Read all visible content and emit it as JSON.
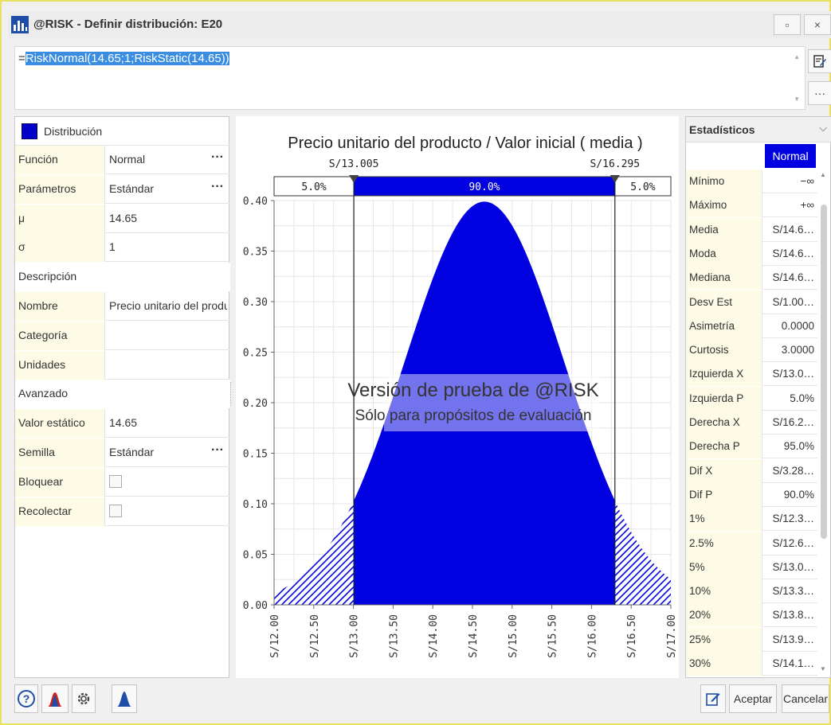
{
  "window": {
    "title": "@RISK - Definir distribución: E20",
    "restore_glyph": "▫",
    "close_glyph": "×"
  },
  "formula": {
    "prefix": "=",
    "selected": "RiskNormal(14.65;1;RiskStatic(14.65))",
    "side_button_1_icon": "edit-icon",
    "side_button_2_label": "···"
  },
  "left_panel": {
    "header_label": "Distribución",
    "swatch_color": "#0000c8",
    "rows": [
      {
        "key": "Función",
        "value": "Normal",
        "has_dots": true,
        "type": "field"
      },
      {
        "key": "Parámetros",
        "value": "Estándar",
        "has_dots": true,
        "type": "field"
      },
      {
        "key": "μ",
        "value": "14.65",
        "has_dots": false,
        "type": "field"
      },
      {
        "key": "σ",
        "value": "1",
        "has_dots": false,
        "type": "field"
      },
      {
        "key": "Descripción",
        "value": "",
        "has_dots": false,
        "type": "section"
      },
      {
        "key": "Nombre",
        "value": "Precio unitario del producto / Valor inicial ( media )",
        "has_dots": false,
        "type": "field"
      },
      {
        "key": "Categoría",
        "value": "",
        "has_dots": false,
        "type": "field"
      },
      {
        "key": "Unidades",
        "value": "",
        "has_dots": false,
        "type": "field"
      },
      {
        "key": "Avanzado",
        "value": "",
        "has_dots": false,
        "type": "section"
      },
      {
        "key": "Valor estático",
        "value": "14.65",
        "has_dots": false,
        "type": "field"
      },
      {
        "key": "Semilla",
        "value": "Estándar",
        "has_dots": true,
        "type": "field"
      },
      {
        "key": "Bloquear",
        "value": "",
        "has_dots": false,
        "type": "checkbox"
      },
      {
        "key": "Recolectar",
        "value": "",
        "has_dots": false,
        "type": "checkbox"
      }
    ],
    "dots_label": "···"
  },
  "chart": {
    "watermark_line1": "Versión de prueba de @RISK",
    "watermark_line2": "Sólo para propósitos de evaluación"
  },
  "chart_data": {
    "type": "area",
    "title": "Precio unitario del producto / Valor inicial ( media )",
    "distribution": "Normal",
    "mean": 14.65,
    "std_dev": 1,
    "xlim": [
      12.0,
      17.0
    ],
    "ylim": [
      0.0,
      0.4
    ],
    "x_ticks": [
      "S/12.00",
      "S/12.50",
      "S/13.00",
      "S/13.50",
      "S/14.00",
      "S/14.50",
      "S/15.00",
      "S/15.50",
      "S/16.00",
      "S/16.50",
      "S/17.00"
    ],
    "x_tick_values": [
      12.0,
      12.5,
      13.0,
      13.5,
      14.0,
      14.5,
      15.0,
      15.5,
      16.0,
      16.5,
      17.0
    ],
    "y_ticks": [
      "0.00",
      "0.05",
      "0.10",
      "0.15",
      "0.20",
      "0.25",
      "0.30",
      "0.35",
      "0.40"
    ],
    "y_tick_values": [
      0.0,
      0.05,
      0.1,
      0.15,
      0.2,
      0.25,
      0.3,
      0.35,
      0.4
    ],
    "left_marker": {
      "value": 13.005,
      "label": "S/13.005"
    },
    "right_marker": {
      "value": 16.295,
      "label": "S/16.295"
    },
    "probability_bar": [
      {
        "label": "5.0%",
        "region": "left"
      },
      {
        "label": "90.0%",
        "region": "middle"
      },
      {
        "label": "5.0%",
        "region": "right"
      }
    ],
    "fill_color": "#0000e0",
    "grid": true
  },
  "stats": {
    "title": "Estadísticos",
    "chevron": "⌵",
    "column_label": "Normal",
    "rows": [
      {
        "key": "Mínimo",
        "value": "−∞"
      },
      {
        "key": "Máximo",
        "value": "+∞"
      },
      {
        "key": "Media",
        "value": "S/14.6…"
      },
      {
        "key": "Moda",
        "value": "S/14.6…"
      },
      {
        "key": "Mediana",
        "value": "S/14.6…"
      },
      {
        "key": "Desv Est",
        "value": "S/1.00…"
      },
      {
        "key": "Asimetría",
        "value": "0.0000"
      },
      {
        "key": "Curtosis",
        "value": "3.0000"
      },
      {
        "key": "Izquierda X",
        "value": "S/13.0…"
      },
      {
        "key": "Izquierda P",
        "value": "5.0%"
      },
      {
        "key": "Derecha X",
        "value": "S/16.2…"
      },
      {
        "key": "Derecha P",
        "value": "95.0%"
      },
      {
        "key": "Dif X",
        "value": "S/3.28…"
      },
      {
        "key": "Dif P",
        "value": "90.0%"
      },
      {
        "key": "1%",
        "value": "S/12.3…"
      },
      {
        "key": "2.5%",
        "value": "S/12.6…"
      },
      {
        "key": "5%",
        "value": "S/13.0…"
      },
      {
        "key": "10%",
        "value": "S/13.3…"
      },
      {
        "key": "20%",
        "value": "S/13.8…"
      },
      {
        "key": "25%",
        "value": "S/13.9…"
      },
      {
        "key": "30%",
        "value": "S/14.1…"
      }
    ]
  },
  "footer": {
    "help_glyph": "?",
    "accept_label": "Aceptar",
    "cancel_label": "Cancelar"
  }
}
